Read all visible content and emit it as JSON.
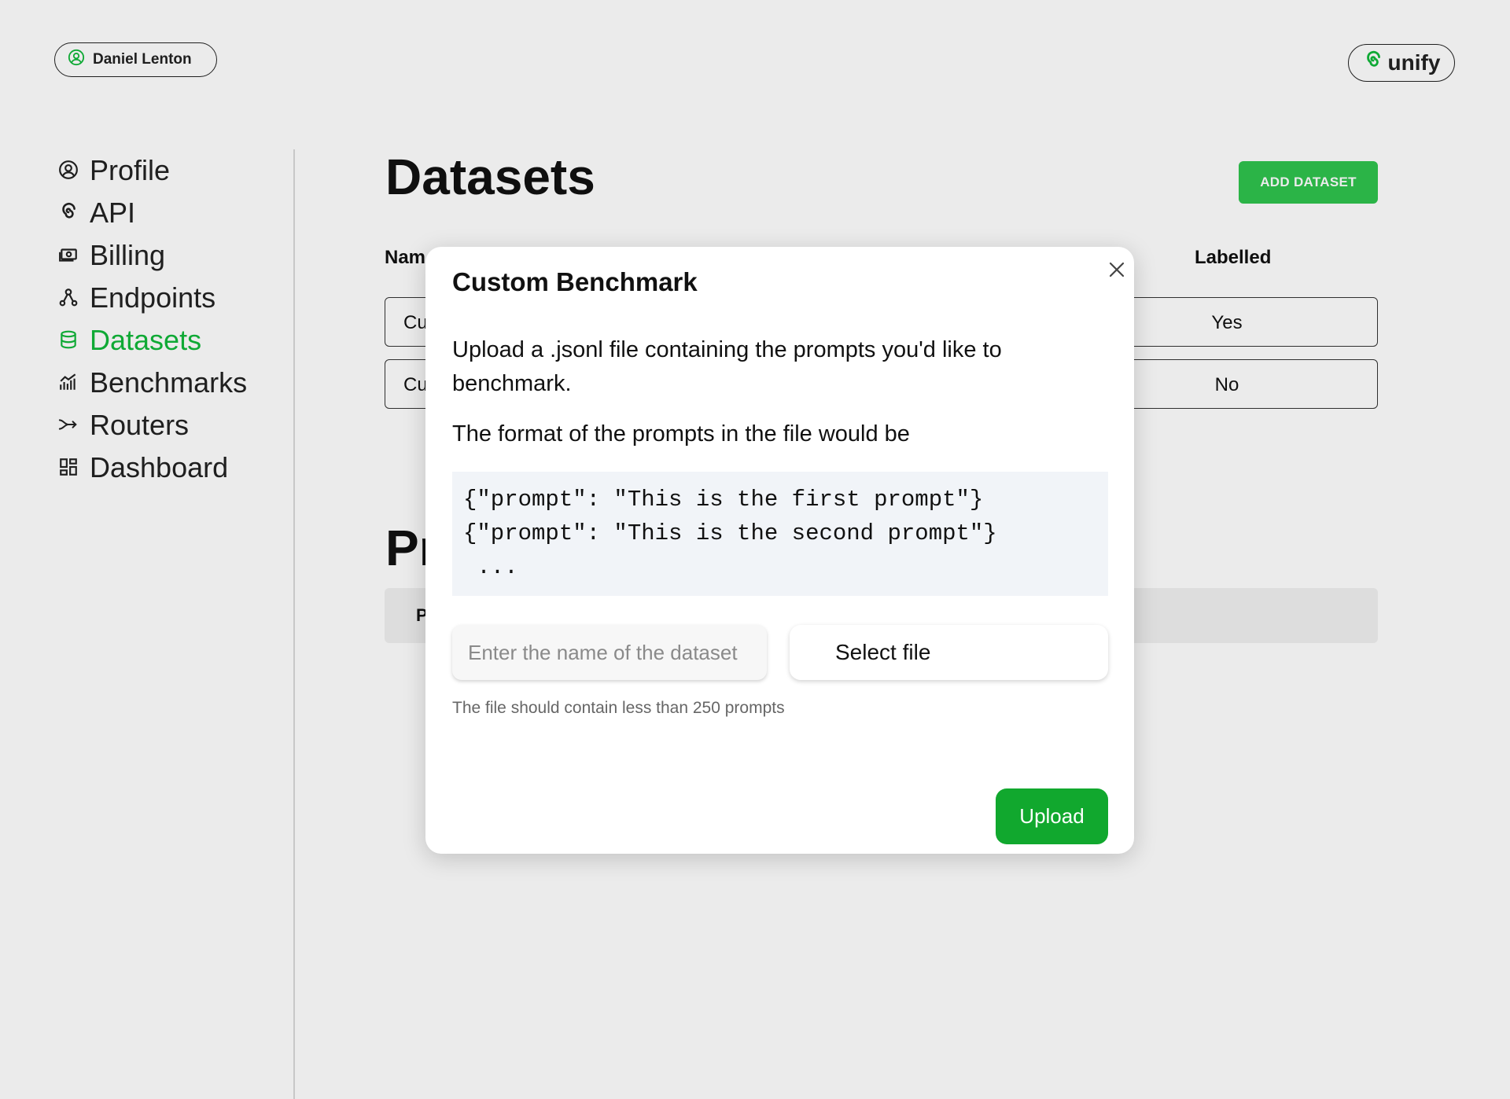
{
  "header": {
    "user_name": "Daniel Lenton",
    "logo_text": "unify"
  },
  "sidebar": {
    "items": [
      {
        "label": "Profile",
        "icon": "profile-icon",
        "active": false
      },
      {
        "label": "API",
        "icon": "spiral-icon",
        "active": false
      },
      {
        "label": "Billing",
        "icon": "billing-icon",
        "active": false
      },
      {
        "label": "Endpoints",
        "icon": "endpoints-icon",
        "active": false
      },
      {
        "label": "Datasets",
        "icon": "database-icon",
        "active": true
      },
      {
        "label": "Benchmarks",
        "icon": "chart-icon",
        "active": false
      },
      {
        "label": "Routers",
        "icon": "router-icon",
        "active": false
      },
      {
        "label": "Dashboard",
        "icon": "dashboard-icon",
        "active": false
      }
    ],
    "active_color": "#11b83a"
  },
  "main": {
    "title": "Datasets",
    "add_button_label": "ADD DATASET",
    "table": {
      "headers": [
        "Nam",
        "Labelled"
      ],
      "rows": [
        {
          "name": "Cu",
          "labelled": "Yes"
        },
        {
          "name": "Cu",
          "labelled": "No"
        }
      ]
    },
    "section2_title": "Pr",
    "section2_header": "P"
  },
  "modal": {
    "title": "Custom Benchmark",
    "description": "Upload a .jsonl file containing the prompts you'd like to benchmark.",
    "format_text": "The format of the prompts in the file would be",
    "code_lines": [
      "{\"prompt\": \"This is the first prompt\"}",
      "{\"prompt\": \"This is the second prompt\"}",
      " ..."
    ],
    "name_placeholder": "Enter the name of the dataset",
    "select_file_label": "Select file",
    "hint": "The file should contain less than 250 prompts",
    "upload_label": "Upload",
    "accent_color": "#11a82e"
  }
}
